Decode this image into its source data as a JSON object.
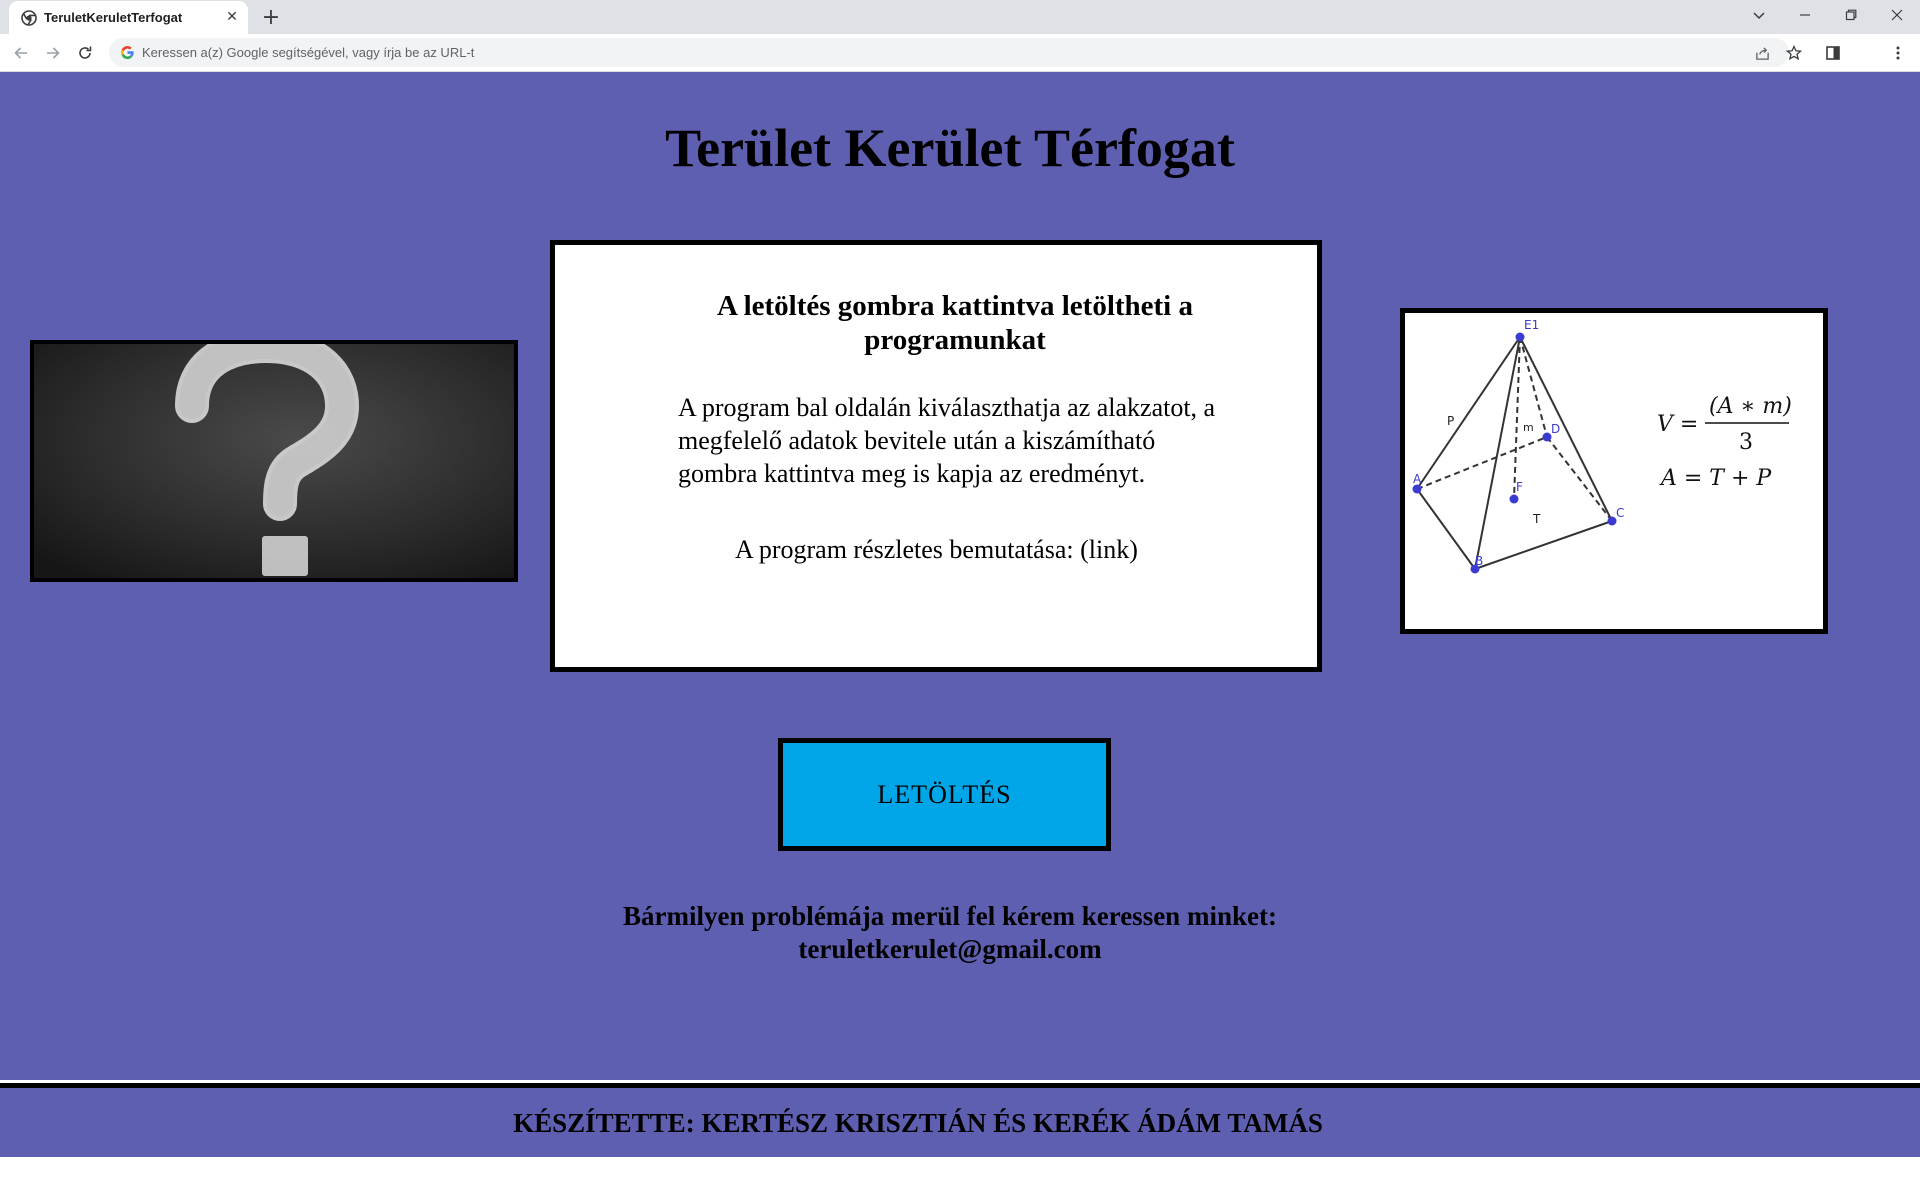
{
  "browser": {
    "tab_title": "TeruletKeruletTerfogat",
    "tab_close": "✕",
    "new_tab": "+",
    "address_placeholder": "Keressen a(z) Google segítségével, vagy írja be az URL-t"
  },
  "page": {
    "title": "Terület Kerület Térfogat",
    "info_heading": "A letöltés gombra kattintva letöltheti a programunkat",
    "info_text": "A program bal oldalán kiválaszthatja az alakzatot, a megfelelő adatok bevitele után a kiszámítható gombra kattintva meg is kapja az eredményt.",
    "info_link_line": "A program részletes bemutatása: (link)",
    "download_label": "LETÖLTÉS",
    "contact_line1": "Bármilyen problémája merül fel kérem keressen minket:",
    "contact_line2": "teruletkerulet@gmail.com",
    "footer": "KÉSZÍTETTE: KERTÉSZ KRISZTIÁN ÉS KERÉK ÁDÁM TAMÁS"
  },
  "pyramid": {
    "vertex_labels": [
      "E1",
      "A",
      "B",
      "C",
      "D",
      "F"
    ],
    "face_labels": [
      "P",
      "T",
      "m"
    ],
    "formula_volume_lhs": "V =",
    "formula_volume_num": "(A ∗ m)",
    "formula_volume_den": "3",
    "formula_area": "A = T + P"
  },
  "colors": {
    "page_background": "#5f5fb1",
    "download_button": "#00a6e7",
    "point_blue": "#3b3bd1"
  },
  "icons": {
    "tab_favicon": "chrome-icon",
    "back": "back-arrow-icon",
    "forward": "forward-arrow-icon",
    "reload": "reload-icon",
    "google": "google-g-icon",
    "share": "share-icon",
    "bookmark": "star-icon",
    "side_panel": "side-panel-icon",
    "menu": "kebab-menu-icon"
  }
}
